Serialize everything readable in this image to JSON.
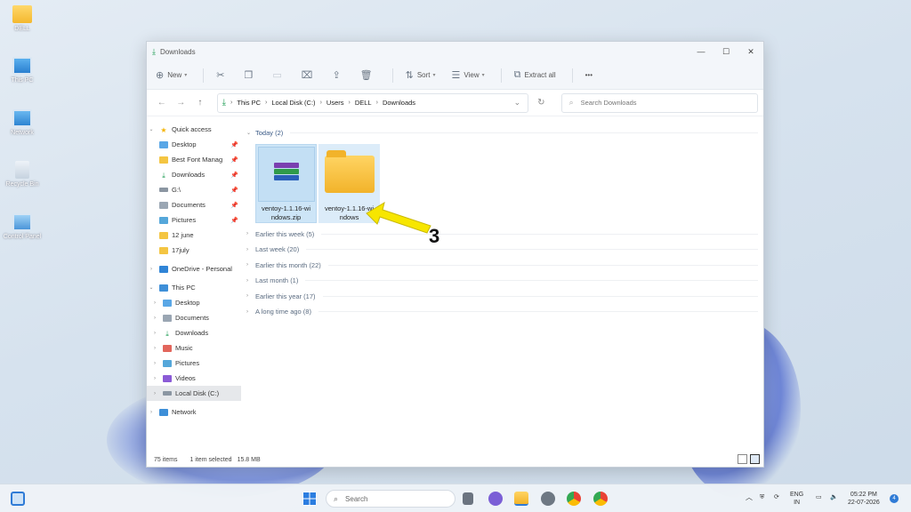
{
  "desktop": {
    "icons": [
      {
        "label": "DELL",
        "icon": "folder-icon"
      },
      {
        "label": "This PC",
        "icon": "computer-icon"
      },
      {
        "label": "Network",
        "icon": "network-icon"
      },
      {
        "label": "Recycle Bin",
        "icon": "recycle-bin-icon"
      },
      {
        "label": "Control Panel",
        "icon": "control-panel-icon"
      }
    ]
  },
  "window": {
    "title": "Downloads",
    "controls": {
      "minimize": "—",
      "maximize": "☐",
      "close": "✕"
    }
  },
  "toolbar": {
    "new_label": "New",
    "sort_label": "Sort",
    "view_label": "View",
    "extract_label": "Extract all",
    "more_label": "•••"
  },
  "address": {
    "crumbs": [
      "This PC",
      "Local Disk (C:)",
      "Users",
      "DELL",
      "Downloads"
    ],
    "search_placeholder": "Search Downloads"
  },
  "sidebar": {
    "quick_access": "Quick access",
    "items": [
      {
        "label": "Desktop",
        "pinned": true
      },
      {
        "label": "Best Font Manag",
        "pinned": true
      },
      {
        "label": "Downloads",
        "pinned": true
      },
      {
        "label": "G:\\",
        "pinned": true
      },
      {
        "label": "Documents",
        "pinned": true
      },
      {
        "label": "Pictures",
        "pinned": true
      },
      {
        "label": "12 june",
        "pinned": false
      },
      {
        "label": "17july",
        "pinned": false
      }
    ],
    "onedrive": "OneDrive - Personal",
    "this_pc": "This PC",
    "pc_items": [
      "Desktop",
      "Documents",
      "Downloads",
      "Music",
      "Pictures",
      "Videos",
      "Local Disk (C:)"
    ],
    "network": "Network"
  },
  "content": {
    "today_group": "Today (2)",
    "files": [
      {
        "label": "ventoy-1.1.16-windows.zip",
        "line1": "ventoy-1.1.16-wi",
        "line2": "ndows.zip",
        "type": "winrar-archive-icon"
      },
      {
        "label": "ventoy-1.1.16-windows",
        "line1": "ventoy-1.1.16-wi",
        "line2": "ndows",
        "type": "folder-icon"
      }
    ],
    "groups": [
      "Earlier this week (5)",
      "Last week (20)",
      "Earlier this month (22)",
      "Last month (1)",
      "Earlier this year (17)",
      "A long time ago (8)"
    ]
  },
  "status": {
    "items": "75 items",
    "selected": "1 item selected",
    "size": "15.8 MB"
  },
  "annotation": {
    "number": "3",
    "color": "#f7e600"
  },
  "taskbar": {
    "search_label": "Search",
    "lang_line1": "ENG",
    "lang_line2": "IN",
    "time": "05:22 PM",
    "date": "22-07-2026",
    "notification_count": "4"
  },
  "colors": {
    "accent": "#2f7bd6",
    "selection": "#cde5f7",
    "folder": "#f4b82e"
  }
}
